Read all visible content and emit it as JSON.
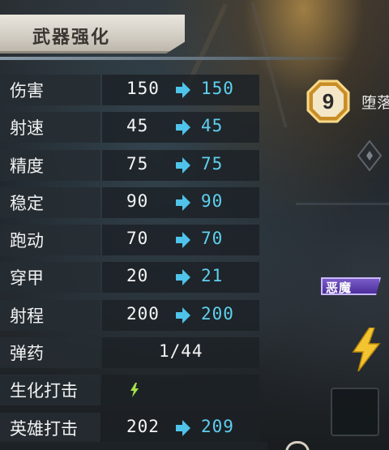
{
  "header": {
    "title": "武器强化"
  },
  "stats": [
    {
      "label": "伤害",
      "current": "150",
      "next": "150"
    },
    {
      "label": "射速",
      "current": "45",
      "next": "45"
    },
    {
      "label": "精度",
      "current": "75",
      "next": "75"
    },
    {
      "label": "稳定",
      "current": "90",
      "next": "90"
    },
    {
      "label": "跑动",
      "current": "70",
      "next": "70"
    },
    {
      "label": "穿甲",
      "current": "20",
      "next": "21"
    },
    {
      "label": "射程",
      "current": "200",
      "next": "200"
    },
    {
      "label": "弹药",
      "value": "1/44"
    },
    {
      "label": "生化打击",
      "icon": "lightning-icon"
    },
    {
      "label": "英雄打击",
      "current": "202",
      "next": "209"
    }
  ],
  "side": {
    "level": "9",
    "name_partial": "堕落",
    "demon_tag": "恶魔"
  },
  "colors": {
    "next_value": "#5fd0f0",
    "arrow": "#4fc3ea",
    "badge_gold": "#d9a23a",
    "demon_purple": "#5b3bb0",
    "bolt_yellow": "#f4c430"
  }
}
